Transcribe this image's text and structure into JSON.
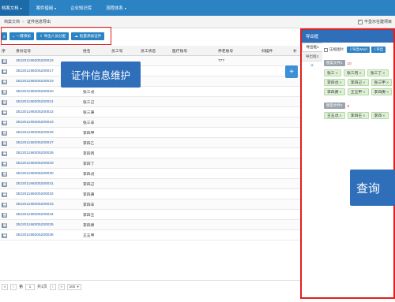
{
  "nav": {
    "items": [
      {
        "label": "档案文档",
        "caret": "▾",
        "active": true
      },
      {
        "label": "案件借阅",
        "caret": "▾",
        "active": false
      },
      {
        "label": "企业知识库",
        "caret": "",
        "active": false
      },
      {
        "label": "流程体系",
        "caret": "▾",
        "active": false
      }
    ]
  },
  "breadcrumb": {
    "items": [
      "档案文档",
      "证件信息导出"
    ],
    "separator": ">",
    "option_label": "不显示在建项目",
    "option_checked": true
  },
  "toolbar": {
    "btn_stub": "≡",
    "btn_add": "一键添加",
    "btn_import": "导出人员分配",
    "btn_batch": "批量添加证件"
  },
  "table": {
    "headers": [
      "序",
      "身份证号",
      "姓名",
      "员工号",
      "员工状态",
      "医疗账号",
      "养老账号",
      "扫描件",
      "补"
    ],
    "rows": [
      {
        "id": "352201198305200018",
        "name": "",
        "extra": "777"
      },
      {
        "id": "352201198305200017",
        "name": "",
        "extra": ""
      },
      {
        "id": "352201198305200019",
        "name": "张三丁",
        "extra": ""
      },
      {
        "id": "352201198305200020",
        "name": "张三戊",
        "extra": ""
      },
      {
        "id": "352201198305200021",
        "name": "张三己",
        "extra": ""
      },
      {
        "id": "352201198305200022",
        "name": "张三庚",
        "extra": ""
      },
      {
        "id": "352201198305200023",
        "name": "张三辛",
        "extra": ""
      },
      {
        "id": "352201198305200026",
        "name": "李四甲",
        "extra": ""
      },
      {
        "id": "352201198305200027",
        "name": "李四乙",
        "extra": ""
      },
      {
        "id": "352201198305200028",
        "name": "李四丙",
        "extra": ""
      },
      {
        "id": "352201198305200029",
        "name": "李四丁",
        "extra": ""
      },
      {
        "id": "352201198305200030",
        "name": "李四戊",
        "extra": ""
      },
      {
        "id": "352201198305200031",
        "name": "李四己",
        "extra": ""
      },
      {
        "id": "352201198305200032",
        "name": "李四庚",
        "extra": ""
      },
      {
        "id": "352201198305200033",
        "name": "李四辛",
        "extra": ""
      },
      {
        "id": "352201198305200034",
        "name": "李四壬",
        "extra": ""
      },
      {
        "id": "352201198305200035",
        "name": "李四癸",
        "extra": ""
      },
      {
        "id": "352201198305200036",
        "name": "王五甲",
        "extra": ""
      }
    ]
  },
  "pager": {
    "first": "«",
    "prev": "‹",
    "page_prefix": "第",
    "page": "1",
    "page_suffix": "共1页",
    "next": "›",
    "last": "»",
    "page_size": "200"
  },
  "callouts": {
    "left": "证件信息维护",
    "right": "查询"
  },
  "fab": "+",
  "panel": {
    "title": "导出框",
    "tabs": [
      "导出框1",
      "导出框2"
    ],
    "add_tab": "+",
    "compress_label": "压缩图片",
    "btn_export_word": "导出Word",
    "btn_export_other": "导出",
    "groups": [
      {
        "label": "图案文件1",
        "count": "10",
        "chips": [
          "张三",
          "张三丙",
          "张三丁",
          "李四戊",
          "李四己",
          "张三甲",
          "李四庚",
          "王五甲",
          "李四庚"
        ]
      },
      {
        "label": "图案文件2",
        "count": "6",
        "chips": [
          "王五戊",
          "李四壬",
          "李四"
        ]
      }
    ]
  },
  "colors": {
    "nav_bg": "#2c83c4",
    "accent": "#2f6fba",
    "highlight_red": "#e02020",
    "chip_bg": "#dff0d8"
  }
}
